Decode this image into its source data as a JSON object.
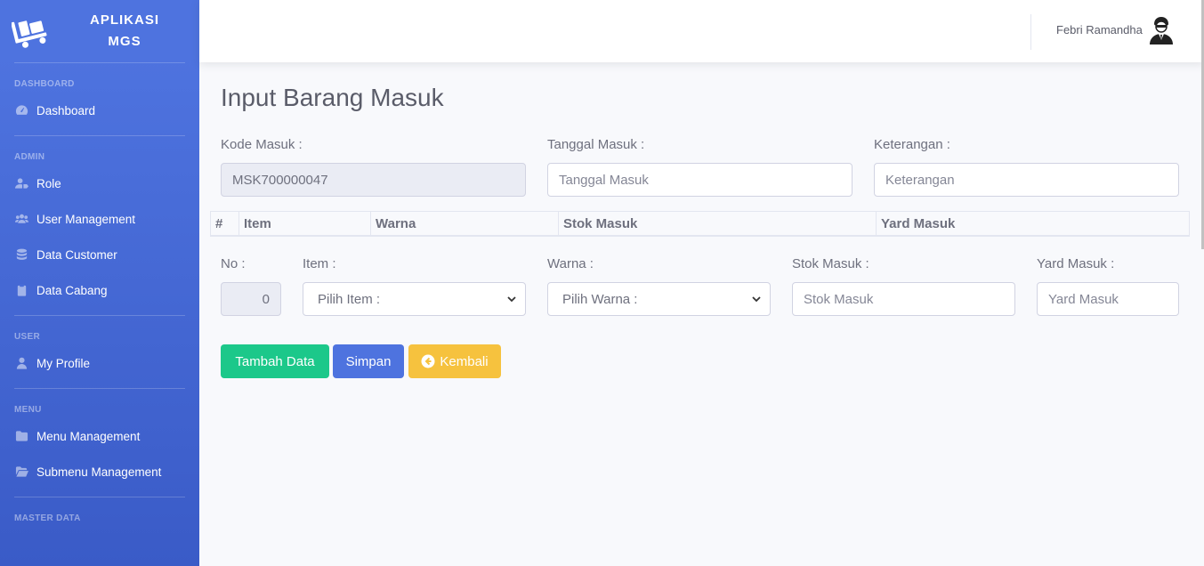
{
  "brand": {
    "line1": "APLIKASI",
    "line2": "MGS",
    "icon": "cart-icon"
  },
  "sidebar": {
    "sections": [
      {
        "heading": "DASHBOARD",
        "items": [
          {
            "label": "Dashboard",
            "icon": "tachometer-icon"
          }
        ]
      },
      {
        "heading": "ADMIN",
        "items": [
          {
            "label": "Role",
            "icon": "user-tag-icon"
          },
          {
            "label": "User Management",
            "icon": "users-icon"
          },
          {
            "label": "Data Customer",
            "icon": "database-icon"
          },
          {
            "label": "Data Cabang",
            "icon": "clipboard-icon"
          }
        ]
      },
      {
        "heading": "USER",
        "items": [
          {
            "label": "My Profile",
            "icon": "user-icon"
          }
        ]
      },
      {
        "heading": "MENU",
        "items": [
          {
            "label": "Menu Management",
            "icon": "folder-icon"
          },
          {
            "label": "Submenu Management",
            "icon": "folder-open-icon"
          }
        ]
      },
      {
        "heading": "MASTER DATA",
        "items": []
      }
    ]
  },
  "topbar": {
    "user_name": "Febri Ramandha"
  },
  "page": {
    "title": "Input Barang Masuk"
  },
  "form": {
    "kode_label": "Kode Masuk :",
    "kode_value": "MSK700000047",
    "tanggal_label": "Tanggal Masuk :",
    "tanggal_placeholder": "Tanggal Masuk",
    "keterangan_label": "Keterangan :",
    "keterangan_placeholder": "Keterangan"
  },
  "table": {
    "headers": [
      "#",
      "Item",
      "Warna",
      "Stok Masuk",
      "Yard Masuk"
    ]
  },
  "row": {
    "no_label": "No :",
    "no_value": "0",
    "item_label": "Item :",
    "item_selected": "Pilih Item :",
    "warna_label": "Warna :",
    "warna_selected": "Pilih Warna :",
    "stok_label": "Stok Masuk :",
    "stok_placeholder": "Stok Masuk",
    "yard_label": "Yard Masuk :",
    "yard_placeholder": "Yard Masuk"
  },
  "buttons": {
    "tambah": "Tambah Data",
    "simpan": "Simpan",
    "kembali": "Kembali"
  },
  "colors": {
    "primary": "#4e73df",
    "success": "#1cc88a",
    "warning": "#f6c23e"
  }
}
